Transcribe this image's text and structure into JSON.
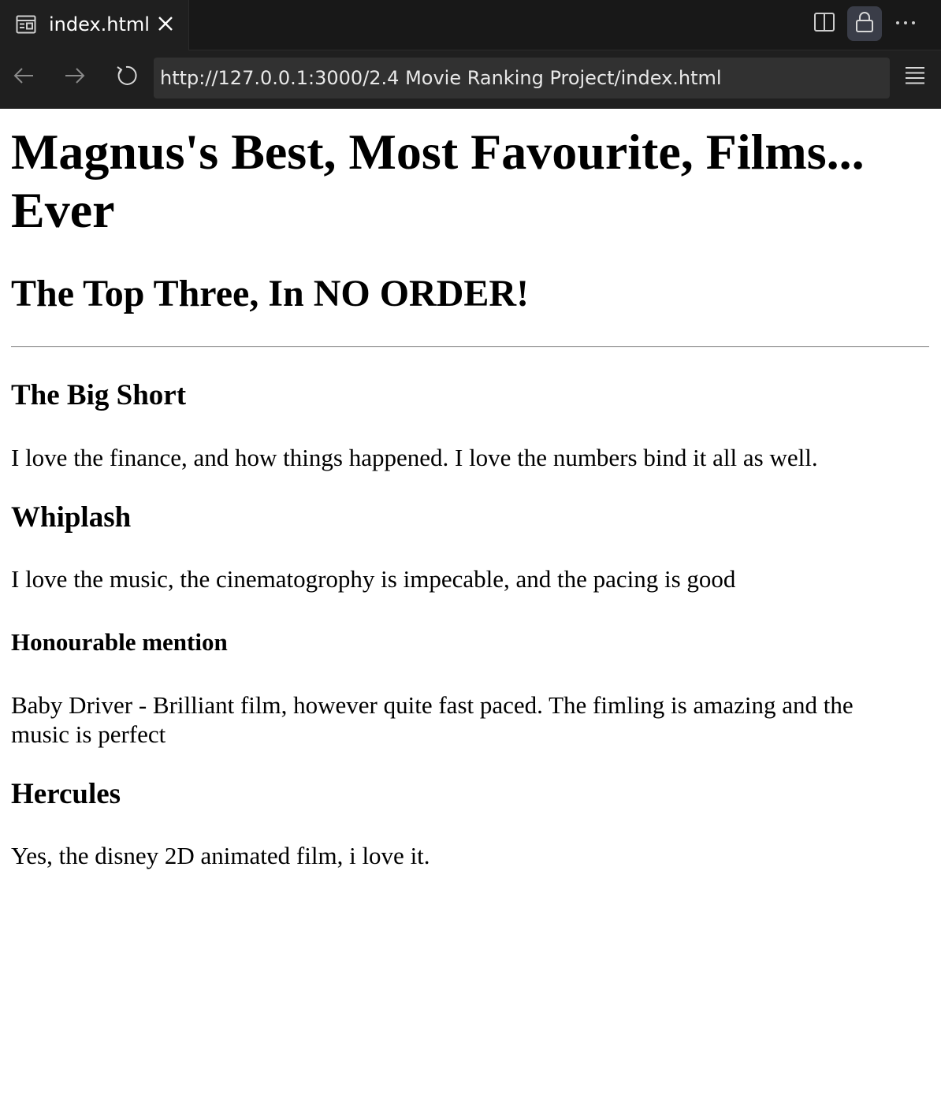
{
  "editor_tab": {
    "label": "index.html",
    "file_icon": "preview-file-icon",
    "close_icon": "close-icon"
  },
  "editor_actions": {
    "split_icon": "split-editor-icon",
    "lock_icon": "lock-icon",
    "more_icon": "more-icon"
  },
  "browser": {
    "back_icon": "arrow-left-icon",
    "forward_icon": "arrow-right-icon",
    "reload_icon": "reload-icon",
    "url": "http://127.0.0.1:3000/2.4 Movie Ranking Project/index.html",
    "menu_icon": "hamburger-menu-icon"
  },
  "page": {
    "title_line1": "Magnus's Best, Most Favourite, Films...",
    "title_line2": "Ever",
    "subtitle": "The Top Three, In NO ORDER!",
    "films": [
      {
        "heading": "The Big Short",
        "description": "I love the finance, and how things happened. I love the numbers bind it all as well."
      },
      {
        "heading": "Whiplash",
        "description": "I love the music, the cinematogrophy is impecable, and the pacing is good"
      }
    ],
    "honourable_mention": {
      "heading": "Honourable mention",
      "description_line1": "Baby Driver - Brilliant film, however quite fast paced. The fimling is amazing and the",
      "description_line2": "music is perfect"
    },
    "extra_film": {
      "heading": "Hercules",
      "description": "Yes, the disney 2D animated film, i love it."
    }
  },
  "colors": {
    "chrome_background": "#1f1f1f",
    "tabstrip_background": "#181818",
    "url_background": "#313131",
    "lock_highlight": "#3a3d48",
    "page_background": "#ffffff"
  }
}
